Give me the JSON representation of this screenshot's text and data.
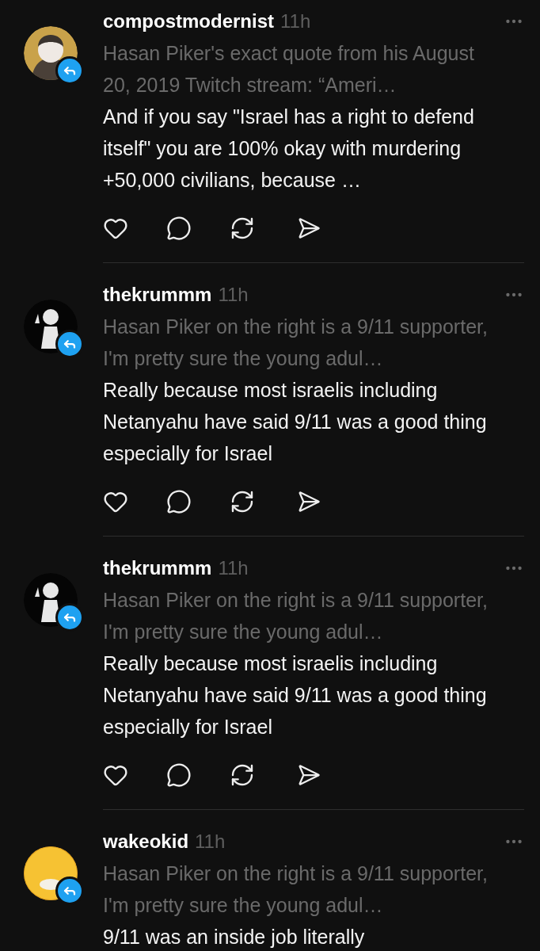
{
  "posts": [
    {
      "username": "compostmodernist",
      "time": "11h",
      "avatar": {
        "kind": "light"
      },
      "quote": "Hasan Piker's exact quote from his August 20, 2019 Twitch stream: “Ameri…",
      "text": "And if you say \"Israel has a right to defend itself\" you are 100% okay with murdering +50,000 civilians, because …",
      "actions_visible": true
    },
    {
      "username": "thekrummm",
      "time": "11h",
      "avatar": {
        "kind": "dark"
      },
      "quote": "Hasan Piker on the right is a 9/11 supporter, I'm pretty sure the young adul…",
      "text": "Really because most israelis including Netanyahu have said 9/11 was a good thing especially for Israel",
      "actions_visible": true
    },
    {
      "username": "thekrummm",
      "time": "11h",
      "avatar": {
        "kind": "dark"
      },
      "quote": "Hasan Piker on the right is a 9/11 supporter, I'm pretty sure the young adul…",
      "text": "Really because most israelis including Netanyahu have said 9/11 was a good thing especially for Israel",
      "actions_visible": true
    },
    {
      "username": "wakeokid",
      "time": "11h",
      "avatar": {
        "kind": "yellow"
      },
      "quote": "Hasan Piker on the right is a 9/11 supporter, I'm pretty sure the young adul…",
      "text": "9/11 was an inside job literally",
      "actions_visible": false
    }
  ]
}
